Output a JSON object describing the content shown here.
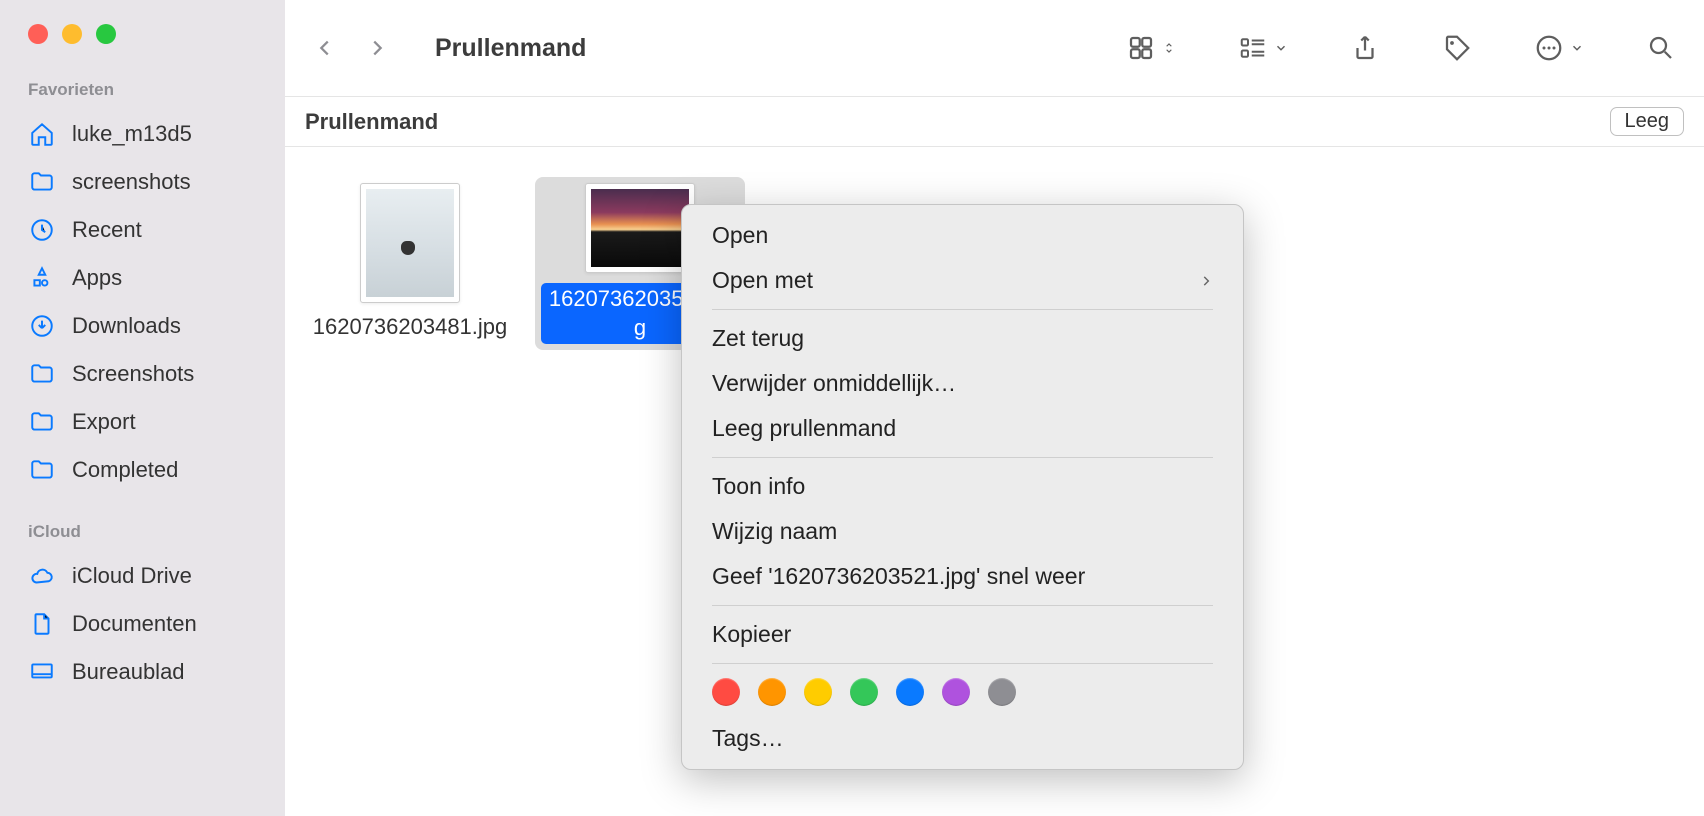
{
  "window": {
    "title": "Prullenmand"
  },
  "pathbar": {
    "label": "Prullenmand",
    "empty_button": "Leeg"
  },
  "sidebar": {
    "sections": [
      {
        "header": "Favorieten",
        "items": [
          {
            "label": "luke_m13d5",
            "icon": "home"
          },
          {
            "label": "screenshots",
            "icon": "folder"
          },
          {
            "label": "Recent",
            "icon": "clock"
          },
          {
            "label": "Apps",
            "icon": "apps"
          },
          {
            "label": "Downloads",
            "icon": "download"
          },
          {
            "label": "Screenshots",
            "icon": "folder"
          },
          {
            "label": "Export",
            "icon": "folder"
          },
          {
            "label": "Completed",
            "icon": "folder"
          }
        ]
      },
      {
        "header": "iCloud",
        "items": [
          {
            "label": "iCloud Drive",
            "icon": "cloud"
          },
          {
            "label": "Documenten",
            "icon": "doc"
          },
          {
            "label": "Bureaublad",
            "icon": "desktop"
          }
        ]
      }
    ]
  },
  "files": [
    {
      "name": "1620736203481.jpg",
      "selected": false
    },
    {
      "name": "1620736203521.jpg",
      "selected": true
    }
  ],
  "context_menu": {
    "items": [
      {
        "label": "Open"
      },
      {
        "label": "Open met",
        "submenu": true
      },
      {
        "sep": true
      },
      {
        "label": "Zet terug"
      },
      {
        "label": "Verwijder onmiddellijk…"
      },
      {
        "label": "Leeg prullenmand"
      },
      {
        "sep": true
      },
      {
        "label": "Toon info"
      },
      {
        "label": "Wijzig naam"
      },
      {
        "label": "Geef '1620736203521.jpg' snel weer"
      },
      {
        "sep": true
      },
      {
        "label": "Kopieer"
      },
      {
        "sep": true
      },
      {
        "tags": [
          "#ff4b42",
          "#ff9500",
          "#ffcc00",
          "#34c759",
          "#0a7aff",
          "#af52de",
          "#8e8e93"
        ]
      },
      {
        "label": "Tags…"
      }
    ]
  }
}
